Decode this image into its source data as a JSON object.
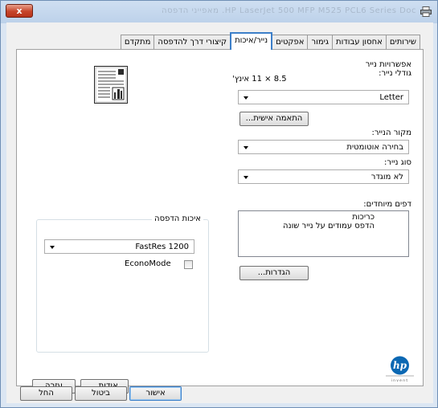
{
  "window": {
    "title": "HP LaserJet 500 MFP M525 PCL6 Series Doc. מאפייני הדפסה",
    "close_label": "x"
  },
  "tabs": [
    {
      "label": "מתקדם",
      "active": false
    },
    {
      "label": "קיצורי דרך להדפסה",
      "active": false
    },
    {
      "label": "נייר/איכות",
      "active": true
    },
    {
      "label": "אפקטים",
      "active": false
    },
    {
      "label": "גימור",
      "active": false
    },
    {
      "label": "אחסון עבודות",
      "active": false
    },
    {
      "label": "שירותים",
      "active": false
    }
  ],
  "paper_options": {
    "title": "אפשרויות נייר",
    "size_label": "גודלי נייר:",
    "size_dimensions": "8.5 × 11 אינץ'",
    "size_value": "Letter",
    "custom_button": "התאמה אישית...",
    "source_label": "מקור הנייר:",
    "source_value": "בחירה אוטומטית",
    "type_label": "סוג נייר:",
    "type_value": "לא מוגדר"
  },
  "special_pages": {
    "label": "דפים מיוחדים:",
    "items": [
      "כריכות",
      "הדפס עמודים על נייר שונה"
    ],
    "settings_button": "הגדרות..."
  },
  "print_quality": {
    "title": "איכות הדפסה",
    "resolution_value": "FastRes 1200",
    "economode_label": "EconoMode",
    "economode_checked": false
  },
  "logo": {
    "text": "hp",
    "tagline": "invent"
  },
  "panel_buttons": {
    "about": "אודות...",
    "help": "עזרה"
  },
  "dialog_buttons": {
    "ok": "אישור",
    "cancel": "ביטול",
    "apply": "החל"
  },
  "colors": {
    "accent": "#3c7fc9",
    "frame": "#dbe6f3",
    "hp_blue": "#0b68b3"
  }
}
